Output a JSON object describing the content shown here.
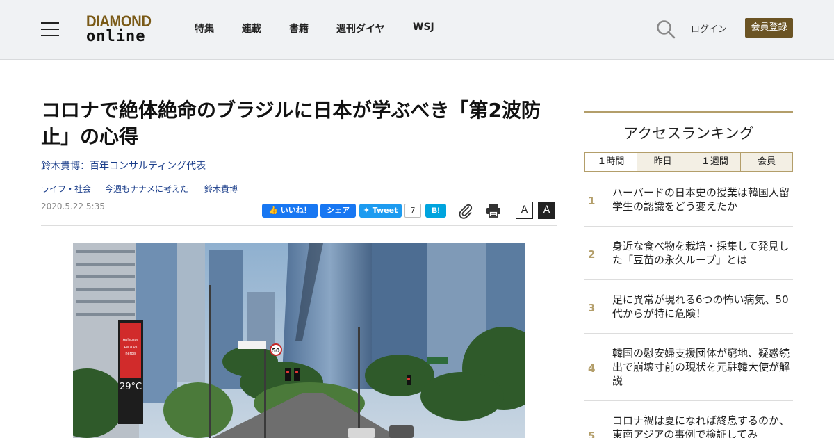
{
  "header": {
    "logo_line1": "DIAMOND",
    "logo_line2": "online",
    "nav": [
      "特集",
      "連載",
      "書籍",
      "週刊ダイヤ",
      "WSJ"
    ],
    "login": "ログイン",
    "register": "会員登録",
    "colors": {
      "background": "#f0f2f4",
      "brand": "#6b5424",
      "logo_gold": "#7a5a17"
    }
  },
  "article": {
    "title": "コロナで絶体絶命のブラジルに日本が学ぶべき「第2波防止」の心得",
    "author": "鈴木貴博：百年コンサルティング代表",
    "tags": [
      "ライフ・社会",
      "今週もナナメに考えた",
      "鈴木貴博"
    ],
    "date": "2020.5.22 5:35",
    "share": {
      "like": "いいね！",
      "share": "シェア",
      "tweet": "Tweet",
      "tweet_count": "7",
      "hatena": "B!"
    },
    "font_small": "A",
    "font_large": "A",
    "photo": {
      "sign_text": "Aplausos para os herois da coleta de lixo e da limpeza. Sábado, 04/04, às 20h.",
      "temperature": "29°C",
      "speed_limit": "50"
    }
  },
  "sidebar": {
    "title": "アクセスランキング",
    "tabs": [
      "１時間",
      "昨日",
      "１週間",
      "会員"
    ],
    "active_tab": "１時間",
    "rankings": [
      {
        "rank": "1",
        "text": "ハーバードの日本史の授業は韓国人留学生の認識をどう変えたか"
      },
      {
        "rank": "2",
        "text": "身近な食べ物を栽培・採集して発見した「豆苗の永久ループ」とは"
      },
      {
        "rank": "3",
        "text": "足に異常が現れる6つの怖い病気、50代からが特に危険！"
      },
      {
        "rank": "4",
        "text": "韓国の慰安婦支援団体が窮地、疑惑続出で崩壊寸前の現状を元駐韓大使が解説"
      },
      {
        "rank": "5",
        "text": "コロナ禍は夏になれば終息するのか、東南アジアの事例で検証してみ"
      }
    ],
    "colors": {
      "accent": "#b39e6a"
    }
  }
}
